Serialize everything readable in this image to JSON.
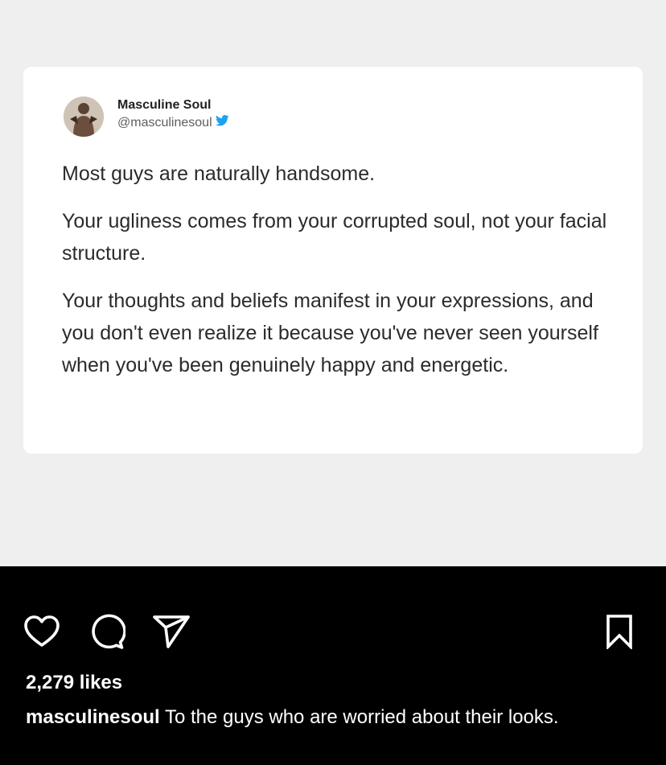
{
  "post": {
    "tweet": {
      "author_name": "Masculine Soul",
      "author_handle": "@masculinesoul",
      "paragraphs": [
        "Most guys are naturally handsome.",
        "Your ugliness comes from your corrupted soul, not your facial structure.",
        "Your thoughts and beliefs manifest in your expressions, and you don't even realize it because you've never seen yourself when you've been genuinely happy and energetic."
      ]
    },
    "likes_text": "2,279 likes",
    "caption": {
      "username": "masculinesoul",
      "text": "To the guys who are worried about their looks."
    }
  },
  "icons": {
    "like": "heart-outline-icon",
    "comment": "comment-bubble-icon",
    "share": "paper-plane-icon",
    "save": "bookmark-outline-icon",
    "verified": "twitter-bird-icon"
  },
  "colors": {
    "feed_background": "#000000",
    "image_background": "#efefef",
    "card_background": "#ffffff",
    "twitter_blue": "#1da1f2",
    "text_primary": "#ffffff"
  }
}
